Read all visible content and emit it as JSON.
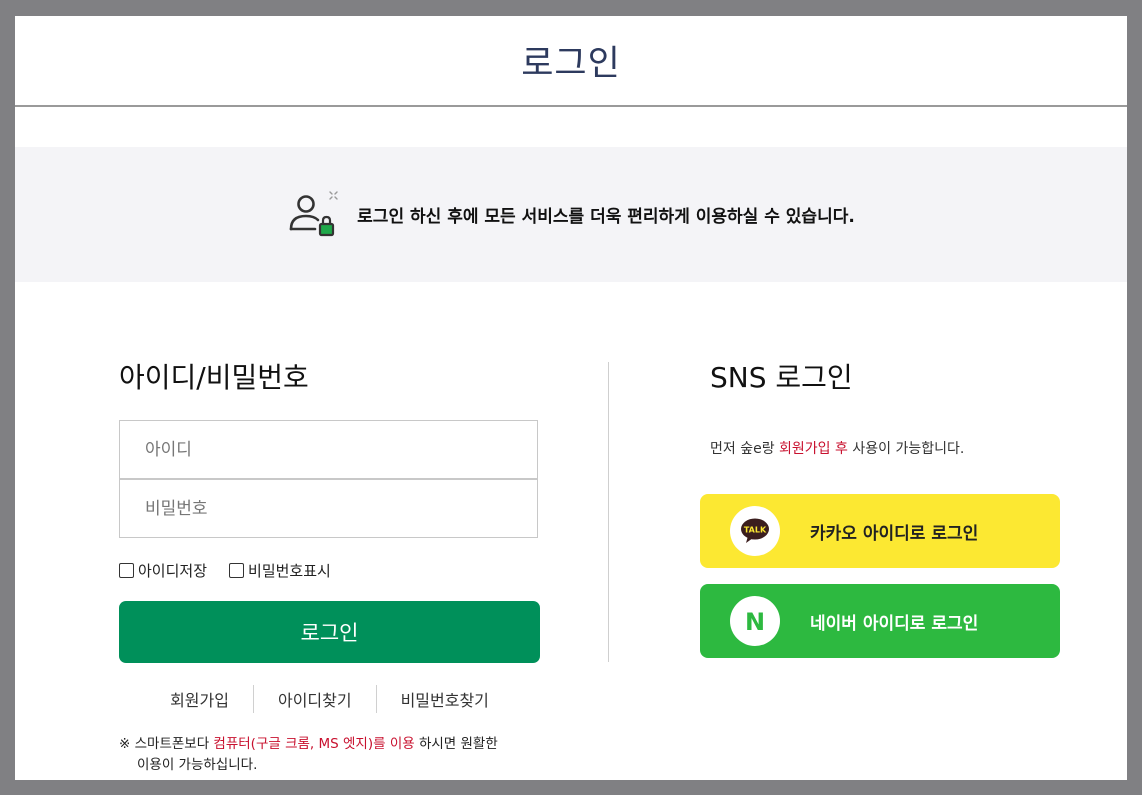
{
  "page": {
    "title": "로그인",
    "notice": "로그인 하신 후에 모든 서비스를 더욱 편리하게 이용하실 수 있습니다."
  },
  "login": {
    "heading": "아이디/비밀번호",
    "id_placeholder": "아이디",
    "pw_placeholder": "비밀번호",
    "save_id_label": "아이디저장",
    "show_pw_label": "비밀번호표시",
    "login_button": "로그인",
    "links": {
      "signup": "회원가입",
      "find_id": "아이디찾기",
      "find_pw": "비밀번호찾기"
    },
    "note": {
      "prefix": "※ 스마트폰보다 ",
      "highlight": "컴퓨터(구글 크롬, MS 엣지)를 이용",
      "suffix": " 하시면 원활한",
      "line2": "이용이 가능하십니다."
    }
  },
  "sns": {
    "heading": "SNS 로그인",
    "note_prefix": "먼저 숲e랑 ",
    "note_highlight": "회원가입 후",
    "note_suffix": " 사용이 가능합니다.",
    "kakao_label": "카카오 아이디로 로그인",
    "kakao_badge": "TALK",
    "naver_label": "네이버 아이디로 로그인",
    "naver_badge": "N"
  },
  "colors": {
    "frame": "#808083",
    "title": "#2d3a5e",
    "login_button": "#00905a",
    "kakao": "#fce832",
    "naver": "#2db940",
    "highlight": "#c8102e"
  },
  "icons": {
    "notice": "user-lock-icon",
    "kakao": "kakao-talk-icon",
    "naver": "naver-n-icon"
  }
}
